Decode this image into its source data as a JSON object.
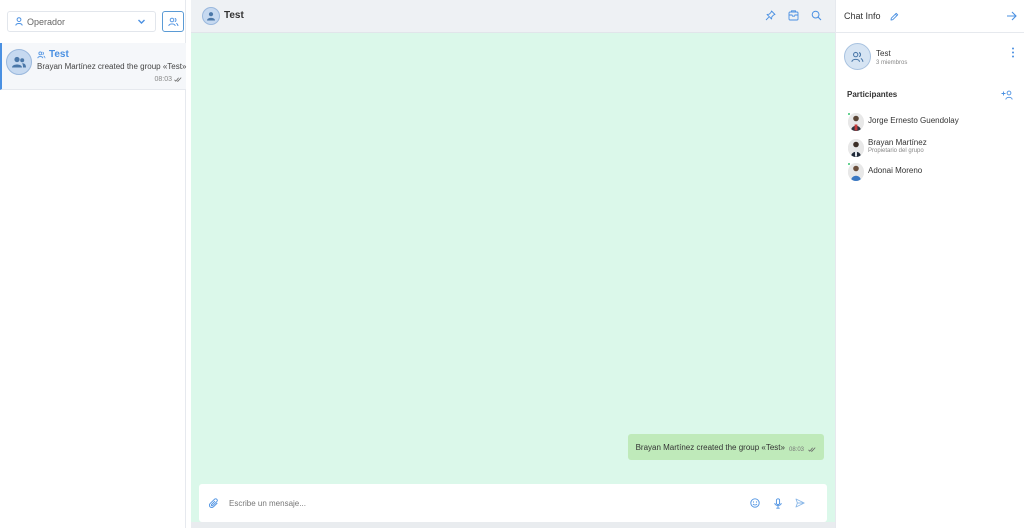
{
  "colors": {
    "accent": "#4a90e2",
    "chat_background": "#dbf8ea",
    "outgoing_bubble": "#bfeaba",
    "online": "#37c36e"
  },
  "sidebar": {
    "operator_select": {
      "label": "Operador",
      "icon": "user-icon"
    },
    "new_group_icon": "group-icon",
    "chats": [
      {
        "name": "Test",
        "type_icon": "group-icon",
        "preview": "Brayan Martínez created the group «Test»",
        "time": "08:03",
        "status_icon": "double-check-icon"
      }
    ]
  },
  "chat": {
    "title": "Test",
    "header_icons": [
      "pin-icon",
      "archive-icon",
      "search-icon"
    ],
    "messages": [
      {
        "text": "Brayan Martínez created the group «Test»",
        "time": "08:03",
        "direction": "outgoing",
        "status_icon": "double-check-icon"
      }
    ],
    "composer": {
      "placeholder": "Escribe un mensaje...",
      "icons": [
        "attach-icon",
        "emoji-icon",
        "microphone-icon",
        "send-icon"
      ]
    }
  },
  "info": {
    "title": "Chat Info",
    "group": {
      "name": "Test",
      "members": "3 miembros"
    },
    "participants_title": "Participantes",
    "participants": [
      {
        "name": "Jorge Ernesto Guendolay",
        "role": ""
      },
      {
        "name": "Brayan Martínez",
        "role": "Propietario del grupo"
      },
      {
        "name": "Adonai Moreno",
        "role": ""
      }
    ]
  }
}
